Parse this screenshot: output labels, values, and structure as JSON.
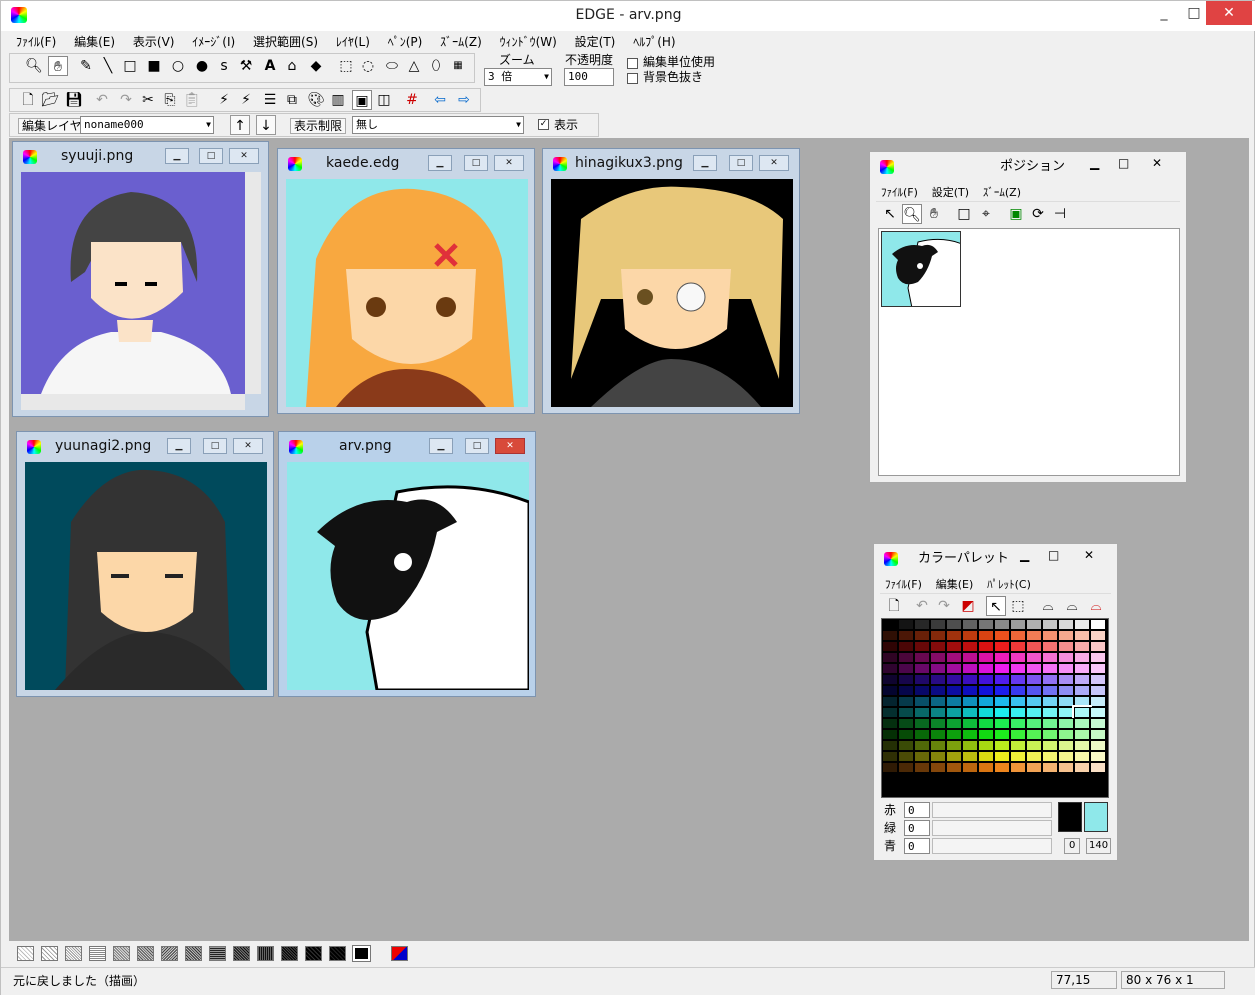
{
  "window": {
    "title": "EDGE - arv.png",
    "min": "_",
    "max": "□",
    "close": "✕"
  },
  "menu": [
    "ﾌｧｲﾙ(F)",
    "編集(E)",
    "表示(V)",
    "ｲﾒｰｼﾞ(I)",
    "選択範囲(S)",
    "ﾚｲﾔ(L)",
    "ﾍﾟﾝ(P)",
    "ｽﾞｰﾑ(Z)",
    "ｳｨﾝﾄﾞｳ(W)",
    "設定(T)",
    "ﾍﾙﾌﾟ(H)"
  ],
  "toolbar1": {
    "zoom_label": "ズーム",
    "zoom_value": "3 倍",
    "opacity_label": "不透明度",
    "opacity_value": "100",
    "chk_edit_unit": "編集単位使用",
    "chk_bg_clear": "背景色抜き"
  },
  "layerbar": {
    "edit_layer_label": "編集レイヤ",
    "edit_layer_value": "noname000",
    "up": "↑",
    "down": "↓",
    "display_limit_label": "表示制限",
    "display_limit_value": "無し",
    "show_label": "表示",
    "show_checked": "✓"
  },
  "docs": [
    {
      "name": "syuuji.png",
      "bg": "#6a5fcf"
    },
    {
      "name": "kaede.edg",
      "bg": "#8fe8ea"
    },
    {
      "name": "hinagikux3.png",
      "bg": "#000000"
    },
    {
      "name": "yuunagi2.png",
      "bg": "#004a5c"
    },
    {
      "name": "arv.png",
      "bg": "#8fe8ea"
    }
  ],
  "position_panel": {
    "title": "ポジション",
    "menu": [
      "ﾌｧｲﾙ(F)",
      "設定(T)",
      "ｽﾞｰﾑ(Z)"
    ]
  },
  "color_palette": {
    "title": "カラーパレット",
    "menu": [
      "ﾌｧｲﾙ(F)",
      "編集(E)",
      "ﾊﾟﾚｯﾄ(C)"
    ],
    "red_label": "赤",
    "green_label": "緑",
    "blue_label": "青",
    "red": "0",
    "green": "0",
    "blue": "0",
    "fg_index": "0",
    "bg_index": "140",
    "fg_color": "#000000",
    "bg_color": "#8fe8ea"
  },
  "status": {
    "message": "元に戻しました（描画）",
    "coords": "77,15",
    "size": "80 x 76 x 1"
  },
  "colors": {
    "accent_close": "#d84a3a",
    "mdi_bg": "#ababab"
  }
}
